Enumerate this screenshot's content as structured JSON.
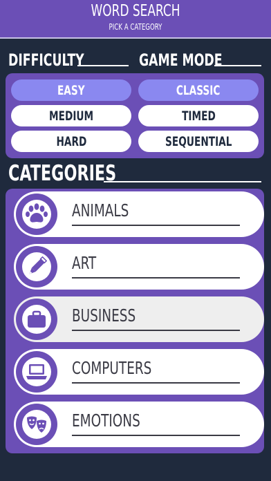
{
  "header": {
    "title": "WORD SEARCH",
    "subtitle": "PICK A CATEGORY"
  },
  "difficulty": {
    "label": "DIFFICULTY",
    "options": [
      {
        "label": "EASY",
        "selected": true
      },
      {
        "label": "MEDIUM",
        "selected": false
      },
      {
        "label": "HARD",
        "selected": false
      }
    ]
  },
  "game_mode": {
    "label": "GAME MODE",
    "options": [
      {
        "label": "CLASSIC",
        "selected": true
      },
      {
        "label": "TIMED",
        "selected": false
      },
      {
        "label": "SEQUENTIAL",
        "selected": false
      }
    ]
  },
  "categories": {
    "label": "CATEGORIES",
    "items": [
      {
        "label": "ANIMALS",
        "icon": "paw-icon"
      },
      {
        "label": "ART",
        "icon": "pencil-icon"
      },
      {
        "label": "BUSINESS",
        "icon": "briefcase-icon"
      },
      {
        "label": "COMPUTERS",
        "icon": "laptop-icon"
      },
      {
        "label": "EMOTIONS",
        "icon": "theater-masks-icon"
      }
    ]
  },
  "colors": {
    "background": "#1f2a3d",
    "accent_purple": "#6b4fb6",
    "selected_option": "#8a88f0"
  }
}
